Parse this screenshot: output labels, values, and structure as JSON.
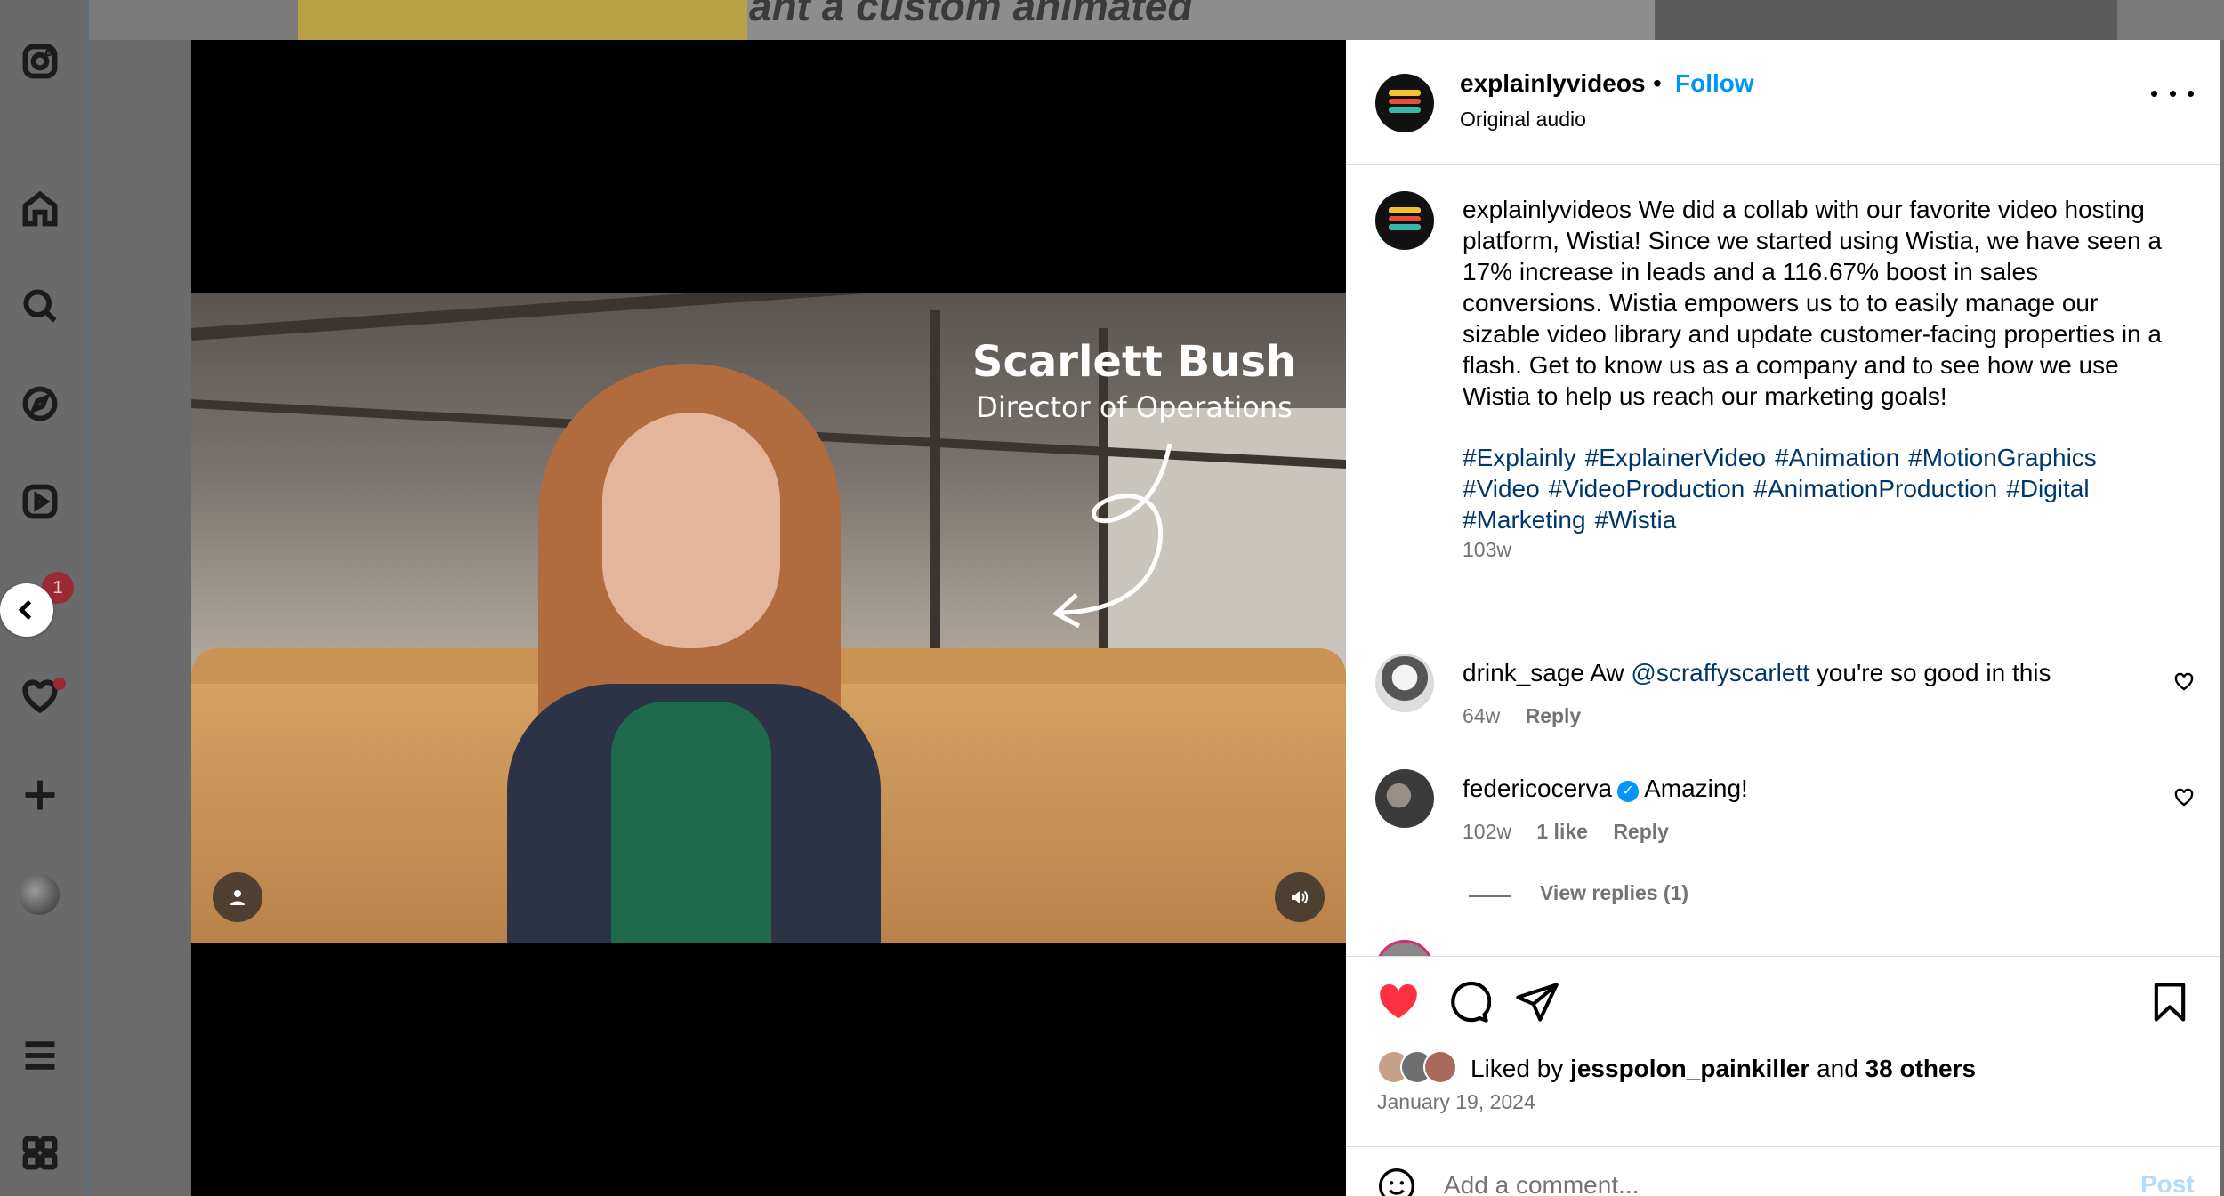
{
  "background": {
    "title_fragment": "ant a custom animated"
  },
  "rail": {
    "notification_count": "1"
  },
  "video": {
    "overlay_name": "Scarlett Bush",
    "overlay_role": "Director of Operations"
  },
  "header": {
    "username": "explainlyvideos",
    "separator": "•",
    "follow_label": "Follow",
    "audio": "Original audio"
  },
  "post": {
    "username": "explainlyvideos",
    "caption": "We did a collab with our favorite video hosting platform, Wistia! Since we started using Wistia, we have seen a 17% increase in leads and a 116.67% boost in sales conversions. Wistia empowers us to to easily manage our sizable video library and update customer-facing properties in a flash. Get to know us as a company and to see how we use Wistia to help us reach our marketing goals!",
    "hashtags": [
      "#Explainly",
      "#ExplainerVideo",
      "#Animation",
      "#MotionGraphics",
      "#Video",
      "#VideoProduction",
      "#AnimationProduction",
      "#Digital",
      "#Marketing",
      "#Wistia"
    ],
    "time": "103w"
  },
  "comments": [
    {
      "user": "drink_sage",
      "pre": "Aw",
      "mention": "@scraffyscarlett",
      "post": "you're so good in this",
      "time": "64w",
      "likes": "",
      "reply": "Reply"
    },
    {
      "user": "federicocerva",
      "text": "Amazing!",
      "time": "102w",
      "likes": "1 like",
      "reply": "Reply",
      "verified": true
    }
  ],
  "view_replies": "View replies (1)",
  "engagement": {
    "liked_by_prefix": "Liked by",
    "liked_by_user": "jesspolon_painkiller",
    "and": "and",
    "others": "38 others",
    "date": "January 19, 2024"
  },
  "add_comment": {
    "placeholder": "Add a comment...",
    "post_label": "Post"
  },
  "colors": {
    "accent": "#0095f6",
    "like_red": "#ff3040",
    "hashtag": "#00376b",
    "muted": "#737373"
  }
}
